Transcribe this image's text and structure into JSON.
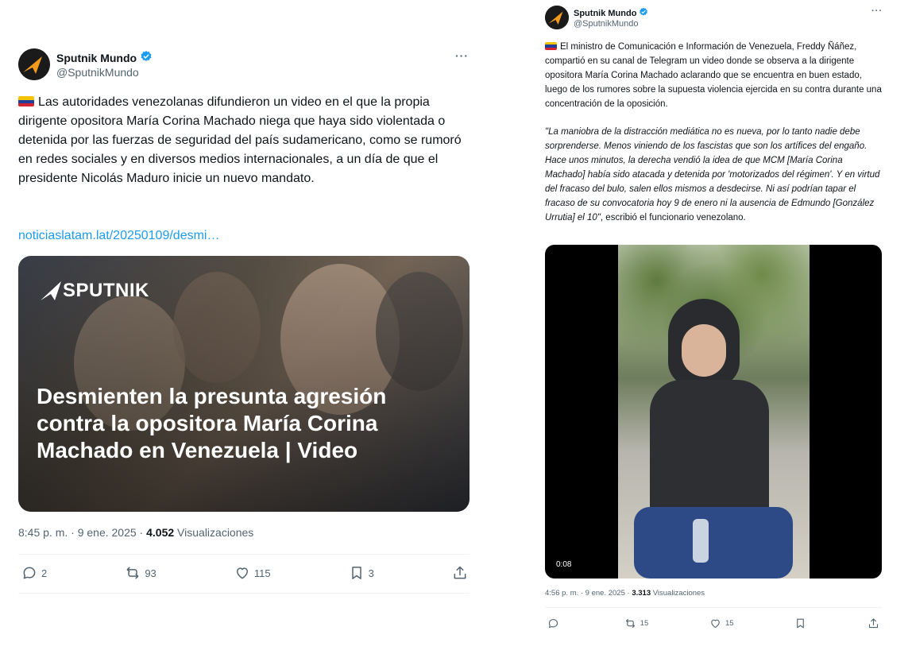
{
  "left_tweet": {
    "author_name": "Sputnik Mundo",
    "author_handle": "@SputnikMundo",
    "more_label": "···",
    "text": "Las autoridades venezolanas difundieron un video en el que la propia dirigente opositora María Corina Machado niega que haya sido violentada o detenida por las fuerzas de seguridad del país sudamericano, como se rumoró en redes sociales y en diversos medios internacionales, a un día de que el presidente Nicolás Maduro inicie un nuevo mandato.",
    "link": "noticiaslatam.lat/20250109/desmi…",
    "card": {
      "logo_text": "SPUTNIK",
      "headline": "Desmienten la presunta agresión contra la opositora María Corina Machado en Venezuela | Video"
    },
    "timestamp": "8:45 p. m. · 9 ene. 2025 · ",
    "views_count": "4.052",
    "views_label": " Visualizaciones",
    "actions": {
      "replies": "2",
      "reposts": "93",
      "likes": "115",
      "bookmarks": "3"
    }
  },
  "right_tweet": {
    "author_name": "Sputnik Mundo",
    "author_handle": "@SputnikMundo",
    "more_label": "···",
    "text": "El ministro de Comunicación e Información de Venezuela, Freddy Ñáñez, compartió en su canal de Telegram un video donde se observa a la dirigente opositora María Corina Machado aclarando que se encuentra en buen estado, luego de los rumores sobre la supuesta violencia ejercida en su contra durante una concentración de la oposición.",
    "quote_italic": "\"La maniobra de la distracción mediática no es nueva, por lo tanto nadie debe sorprenderse. Menos viniendo de los fascistas que son los artífices del engaño. Hace unos minutos, la derecha vendió la idea de que MCM [María Corina Machado] había sido atacada y detenida por 'motorizados del régimen'. Y en virtud del fracaso del bulo, salen ellos mismos a desdecirse. Ni así podrían tapar el fracaso de su convocatoria hoy 9 de enero ni la ausencia de Edmundo [González Urrutia] el 10\"",
    "quote_tail": ", escribió el funcionario venezolano.",
    "video_time": "0:08",
    "timestamp": "4:56 p. m. · 9 ene. 2025 · ",
    "views_count": "3.313",
    "views_label": " Visualizaciones",
    "actions": {
      "replies": "",
      "reposts": "15",
      "likes": "15"
    }
  },
  "colors": {
    "verified": "#1d9bf0",
    "link": "#1d9bf0",
    "secondary_text": "#536471",
    "flag_yellow": "#f4c400",
    "flag_blue": "#1f3f9b",
    "flag_red": "#d3232e",
    "sputnik_orange": "#f39a1d"
  },
  "icons": [
    "reply-icon",
    "repost-icon",
    "like-icon",
    "bookmark-icon",
    "share-icon",
    "verified-badge-icon",
    "more-icon",
    "venezuela-flag-icon",
    "sputnik-logo-icon"
  ]
}
